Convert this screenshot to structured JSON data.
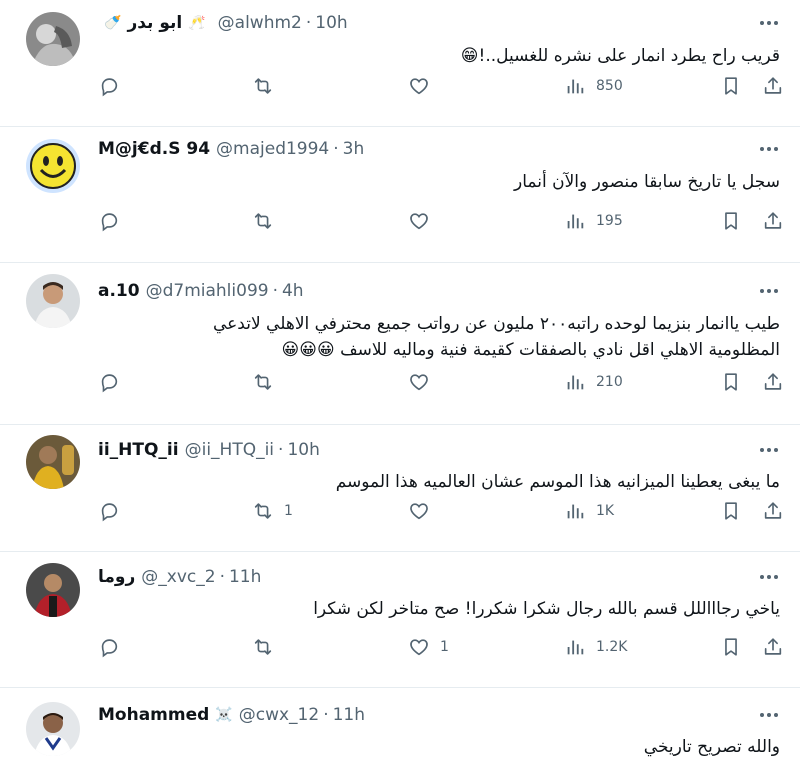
{
  "tweets": [
    {
      "name": "ابو بدر",
      "name_badges": [
        "🍼",
        "🥂"
      ],
      "handle": "@alwhm2",
      "time": "10h",
      "text": "قريب راح يطرد انمار على نشره للغسيل..!😁",
      "replies": "",
      "retweets": "",
      "likes": "",
      "views": "850"
    },
    {
      "name": "M@j€d.S 94",
      "name_badges": [],
      "handle": "@majed1994",
      "time": "3h",
      "text": "سجل يا تاريخ سابقا منصور والآن أنمار",
      "replies": "",
      "retweets": "",
      "likes": "",
      "views": "195"
    },
    {
      "name": "a.10",
      "name_badges": [],
      "handle": "@d7miahli099",
      "time": "4h",
      "text_line1": "طيب ياانمار بنزيما لوحده  راتبه٢٠٠ مليون عن رواتب جميع محترفي الاهلي لاتدعي",
      "text_line2": "المظلومية الاهلي اقل نادي بالصفقات كقيمة فنية وماليه للاسف 😀😀😀",
      "replies": "",
      "retweets": "",
      "likes": "",
      "views": "210"
    },
    {
      "name": "ii_HTQ_ii",
      "name_badges": [],
      "handle": "@ii_HTQ_ii",
      "time": "10h",
      "text": "ما يبغى يعطينا الميزانيه هذا الموسم عشان العالميه هذا الموسم",
      "replies": "",
      "retweets": "1",
      "likes": "",
      "views": "1K"
    },
    {
      "name": "روما",
      "name_badges": [],
      "handle": "@_xvc_2",
      "time": "11h",
      "text": "ياخي رجاااللل قسم بالله رجال شكرا شكررا! صح متاخر لكن شكرا",
      "replies": "",
      "retweets": "",
      "likes": "1",
      "views": "1.2K"
    },
    {
      "name": "Mohammed",
      "name_badges": [
        "☠️"
      ],
      "handle": "@cwx_12",
      "time": "11h",
      "text": "والله تصريح تاريخي"
    }
  ],
  "separator": "·",
  "icons": {
    "reply": "reply-icon",
    "retweet": "retweet-icon",
    "like": "heart-icon",
    "views": "views-icon",
    "bookmark": "bookmark-icon",
    "share": "share-icon",
    "more": "more-icon"
  },
  "colors": {
    "text": "#0f1419",
    "secondary": "#536471",
    "border": "#e6ecf0"
  }
}
